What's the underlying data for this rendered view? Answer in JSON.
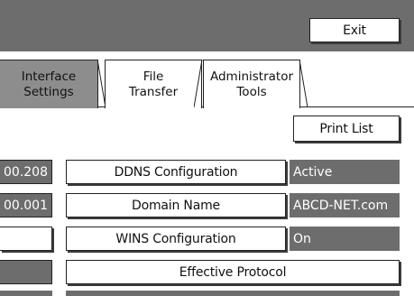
{
  "header": {
    "exit_label": "Exit"
  },
  "tabs": [
    {
      "line1": "Interface",
      "line2": "Settings",
      "active": true
    },
    {
      "line1": "File",
      "line2": "Transfer",
      "active": false
    },
    {
      "line1": "Administrator",
      "line2": "Tools",
      "active": false
    }
  ],
  "toolbar": {
    "print_list_label": "Print List"
  },
  "rows": [
    {
      "left_value": "00.208",
      "label": "DDNS Configuration",
      "value": "Active"
    },
    {
      "left_value": "00.001",
      "label": "Domain Name",
      "value": "ABCD-NET.com"
    },
    {
      "left_value": "",
      "label": "WINS Configuration",
      "value": "On"
    }
  ],
  "effective_protocol_label": "Effective Protocol",
  "colors": {
    "panel_gray": "#6d6d6d",
    "active_tab": "#8d8d8d"
  }
}
